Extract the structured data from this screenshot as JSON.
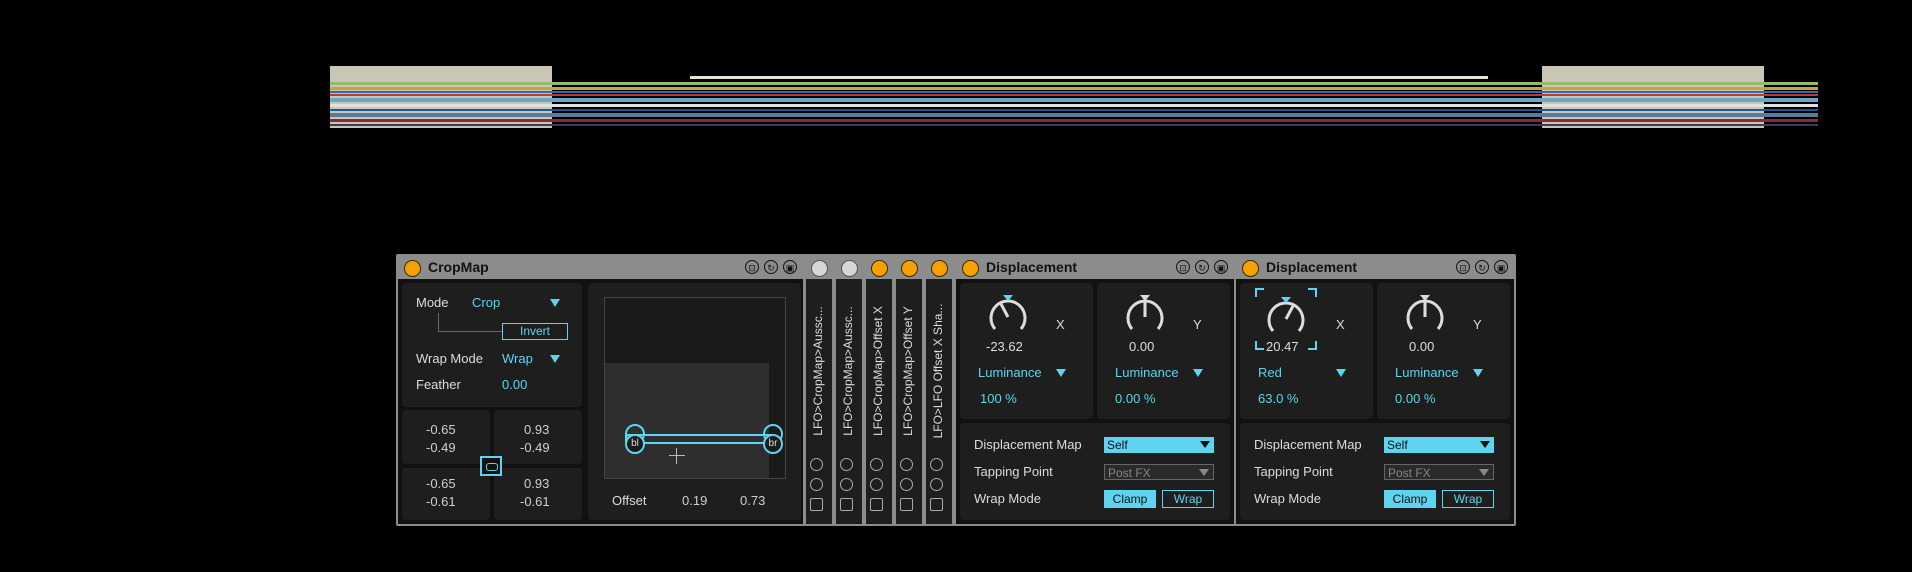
{
  "colors": {
    "accent": "#5fd4ee",
    "power_on": "#f5a200",
    "frame": "#8c8c8c",
    "panel": "#1e1e1e"
  },
  "cropmap": {
    "title": "CropMap",
    "mode_label": "Mode",
    "mode_value": "Crop",
    "invert_label": "Invert",
    "wrap_label": "Wrap Mode",
    "wrap_value": "Wrap",
    "feather_label": "Feather",
    "feather_value": "0.00",
    "corners": {
      "tl_x": "-0.65",
      "tl_y": "-0.49",
      "tr_x": "0.93",
      "tr_y": "-0.49",
      "bl_x": "-0.65",
      "bl_y": "-0.61",
      "br_x": "0.93",
      "br_y": "-0.61"
    },
    "handle_bl": "bl",
    "handle_br": "br",
    "offset_label": "Offset",
    "offset_x": "0.19",
    "offset_y": "0.73"
  },
  "lfos": [
    {
      "label": "LFO>CropMap>Aussc...",
      "on": false
    },
    {
      "label": "LFO>CropMap>Aussc...",
      "on": false
    },
    {
      "label": "LFO>CropMap>Offset X",
      "on": true
    },
    {
      "label": "LFO>CropMap>Offset Y",
      "on": true
    },
    {
      "label": "LFO>LFO Offset X Sha...",
      "on": true
    }
  ],
  "displacement1": {
    "title": "Displacement",
    "x_value": "-23.62",
    "x_label": "X",
    "x_source": "Luminance",
    "x_amount": "100 %",
    "y_value": "0.00",
    "y_label": "Y",
    "y_source": "Luminance",
    "y_amount": "0.00 %",
    "map_label": "Displacement Map",
    "map_value": "Self",
    "tap_label": "Tapping Point",
    "tap_value": "Post FX",
    "wrap_label": "Wrap Mode",
    "clamp": "Clamp",
    "wrap": "Wrap"
  },
  "displacement2": {
    "title": "Displacement",
    "x_value": "20.47",
    "x_label": "X",
    "x_source": "Red",
    "x_amount": "63.0 %",
    "y_value": "0.00",
    "y_label": "Y",
    "y_source": "Luminance",
    "y_amount": "0.00 %",
    "map_label": "Displacement Map",
    "map_value": "Self",
    "tap_label": "Tapping Point",
    "tap_value": "Post FX",
    "wrap_label": "Wrap Mode",
    "clamp": "Clamp",
    "wrap": "Wrap"
  }
}
